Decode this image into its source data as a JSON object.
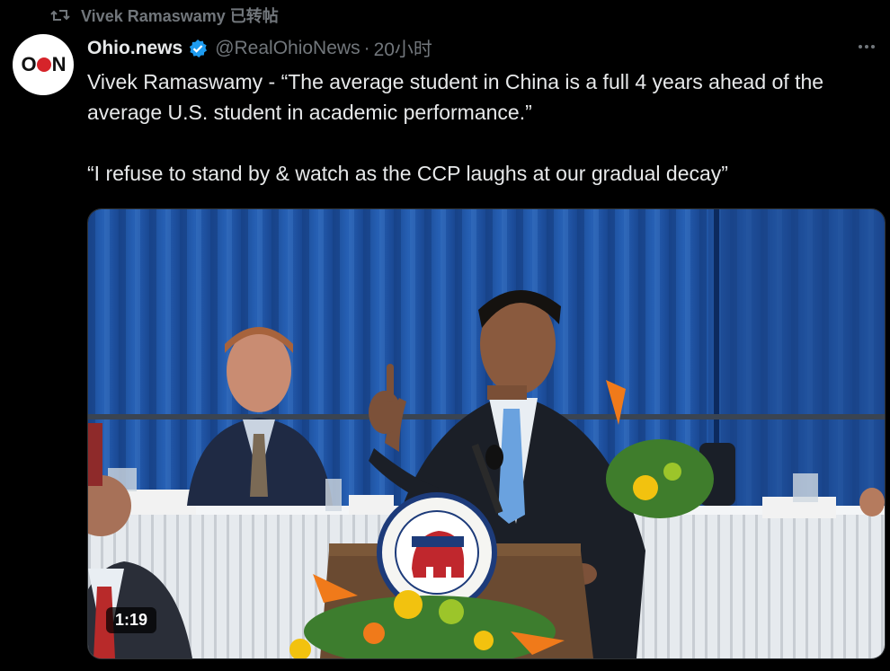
{
  "repost": {
    "icon": "repost-icon",
    "text": "Vivek Ramaswamy 已转帖"
  },
  "author": {
    "avatar_icon": "ohio-news-logo",
    "display_name": "Ohio.news",
    "verified_icon": "verified-badge-icon",
    "handle": "@RealOhioNews",
    "separator": "·",
    "time": "20小时"
  },
  "more_icon": "more-options-icon",
  "tweet": {
    "line1": "Vivek Ramaswamy - “The average student in China is a full 4 years ahead of the average U.S. student in academic performance.”",
    "line2": "“I refuse to stand by & watch as the CCP laughs at our gradual decay”"
  },
  "media": {
    "type": "video",
    "duration": "1:19",
    "colors": {
      "curtain": "#1d4f9c",
      "tablecloth": "#e8ecef",
      "podium": "#6b4a2e",
      "verified": "#1d9bf0"
    }
  }
}
